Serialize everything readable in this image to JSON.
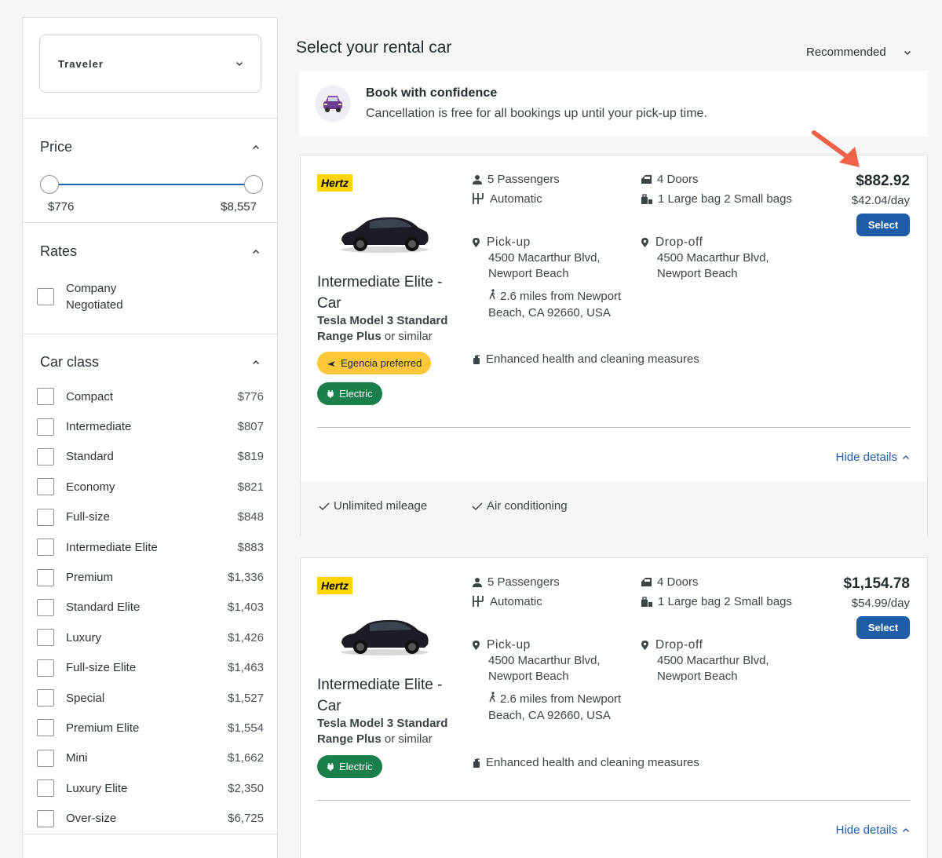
{
  "sidebar": {
    "traveler": {
      "label": "Traveler"
    },
    "price": {
      "title": "Price",
      "min_label": "$776",
      "max_label": "$8,557",
      "range_low_fraction": 0.0,
      "range_high_fraction": 1.0
    },
    "rates": {
      "title": "Rates",
      "option": "Company Negotiated"
    },
    "car_class": {
      "title": "Car class",
      "items": [
        {
          "name": "Compact",
          "price": "$776"
        },
        {
          "name": "Intermediate",
          "price": "$807"
        },
        {
          "name": "Standard",
          "price": "$819"
        },
        {
          "name": "Economy",
          "price": "$821"
        },
        {
          "name": "Full-size",
          "price": "$848"
        },
        {
          "name": "Intermediate Elite",
          "price": "$883"
        },
        {
          "name": "Premium",
          "price": "$1,336"
        },
        {
          "name": "Standard Elite",
          "price": "$1,403"
        },
        {
          "name": "Luxury",
          "price": "$1,426"
        },
        {
          "name": "Full-size Elite",
          "price": "$1,463"
        },
        {
          "name": "Special",
          "price": "$1,527"
        },
        {
          "name": "Premium Elite",
          "price": "$1,554"
        },
        {
          "name": "Mini",
          "price": "$1,662"
        },
        {
          "name": "Luxury Elite",
          "price": "$2,350"
        },
        {
          "name": "Over-size",
          "price": "$6,725"
        }
      ]
    }
  },
  "main": {
    "title": "Select your rental car",
    "sort_label": "Recommended",
    "confidence": {
      "title": "Book with confidence",
      "description": "Cancellation is free for all bookings up until your pick-up time."
    },
    "cards": [
      {
        "vendor": "Hertz",
        "title": "Intermediate Elite - Car",
        "model_bold": "Tesla Model 3 Standard Range Plus",
        "model_suffix": " or similar",
        "badge_preferred": "Egencia preferred",
        "badge_electric": "Electric",
        "passengers": "5 Passengers",
        "transmission": "Automatic",
        "doors": "4 Doors",
        "bags": "1 Large bag 2 Small bags",
        "pickup_label": "Pick-up",
        "pickup_address": "4500 Macarthur Blvd, Newport Beach",
        "distance": "2.6 miles from Newport Beach, CA 92660, USA",
        "dropoff_label": "Drop-off",
        "dropoff_address": "4500 Macarthur Blvd, Newport Beach",
        "health": "Enhanced health and cleaning measures",
        "total_price": "$882.92",
        "daily_price": "$42.04/day",
        "select_label": "Select",
        "hide_details": "Hide details",
        "extras": [
          "Unlimited mileage",
          "Air conditioning"
        ]
      },
      {
        "vendor": "Hertz",
        "title": "Intermediate Elite - Car",
        "model_bold": "Tesla Model 3 Standard Range Plus",
        "model_suffix": " or similar",
        "badge_electric": "Electric",
        "passengers": "5 Passengers",
        "transmission": "Automatic",
        "doors": "4 Doors",
        "bags": "1 Large bag 2 Small bags",
        "pickup_label": "Pick-up",
        "pickup_address": "4500 Macarthur Blvd, Newport Beach",
        "distance": "2.6 miles from Newport Beach, CA 92660, USA",
        "dropoff_label": "Drop-off",
        "dropoff_address": "4500 Macarthur Blvd, Newport Beach",
        "health": "Enhanced health and cleaning measures",
        "total_price": "$1,154.78",
        "daily_price": "$54.99/day",
        "select_label": "Select",
        "hide_details": "Hide details"
      }
    ]
  },
  "colors": {
    "accent": "#1f5ca8",
    "vendor_yellow": "#ffd400",
    "preferred_badge": "#fcc83a",
    "electric_badge": "#1a7f4b",
    "annotation_arrow": "#f0614a"
  },
  "icons": [
    "chevron-down-icon",
    "chevron-up-icon",
    "person-icon",
    "transmission-icon",
    "door-icon",
    "luggage-icon",
    "location-pin-icon",
    "walking-icon",
    "hand-sanitizer-icon",
    "plane-icon",
    "plug-icon",
    "checkmark-icon",
    "car-icon",
    "arrow-annotation"
  ]
}
